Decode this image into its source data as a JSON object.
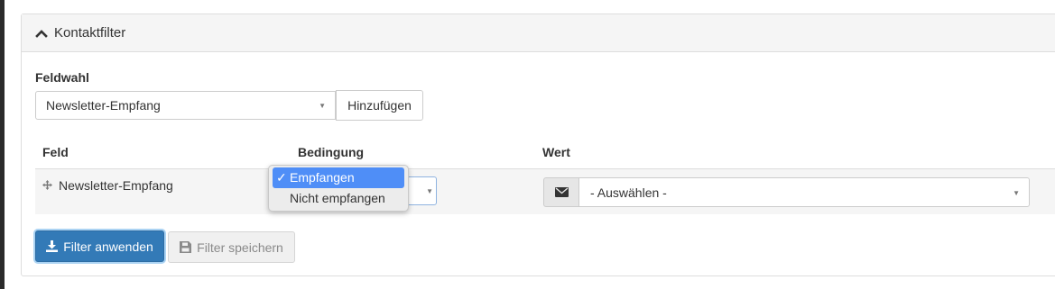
{
  "panel": {
    "title": "Kontaktfilter"
  },
  "field_selection": {
    "label": "Feldwahl",
    "selected": "Newsletter-Empfang",
    "add_label": "Hinzufügen"
  },
  "table": {
    "headers": [
      "Feld",
      "Bedingung",
      "Wert"
    ],
    "rows": [
      {
        "field": "Newsletter-Empfang",
        "value_placeholder": "- Auswählen -"
      }
    ]
  },
  "condition_dropdown": {
    "options": [
      {
        "label": "Empfangen",
        "selected": true,
        "check": "✓"
      },
      {
        "label": "Nicht empfangen",
        "selected": false
      }
    ]
  },
  "actions": {
    "apply_label": "Filter anwenden",
    "save_label": "Filter speichern"
  },
  "icons": {
    "heading": "chevron-up-icon",
    "row_handle": "move-icon",
    "value_addon": "envelope-icon",
    "apply": "download-icon",
    "save": "floppy-disk-icon"
  },
  "colors": {
    "primary": "#337ab7",
    "dropdown_highlight": "#4f8ef7",
    "panel_heading_bg": "#f5f5f5"
  }
}
